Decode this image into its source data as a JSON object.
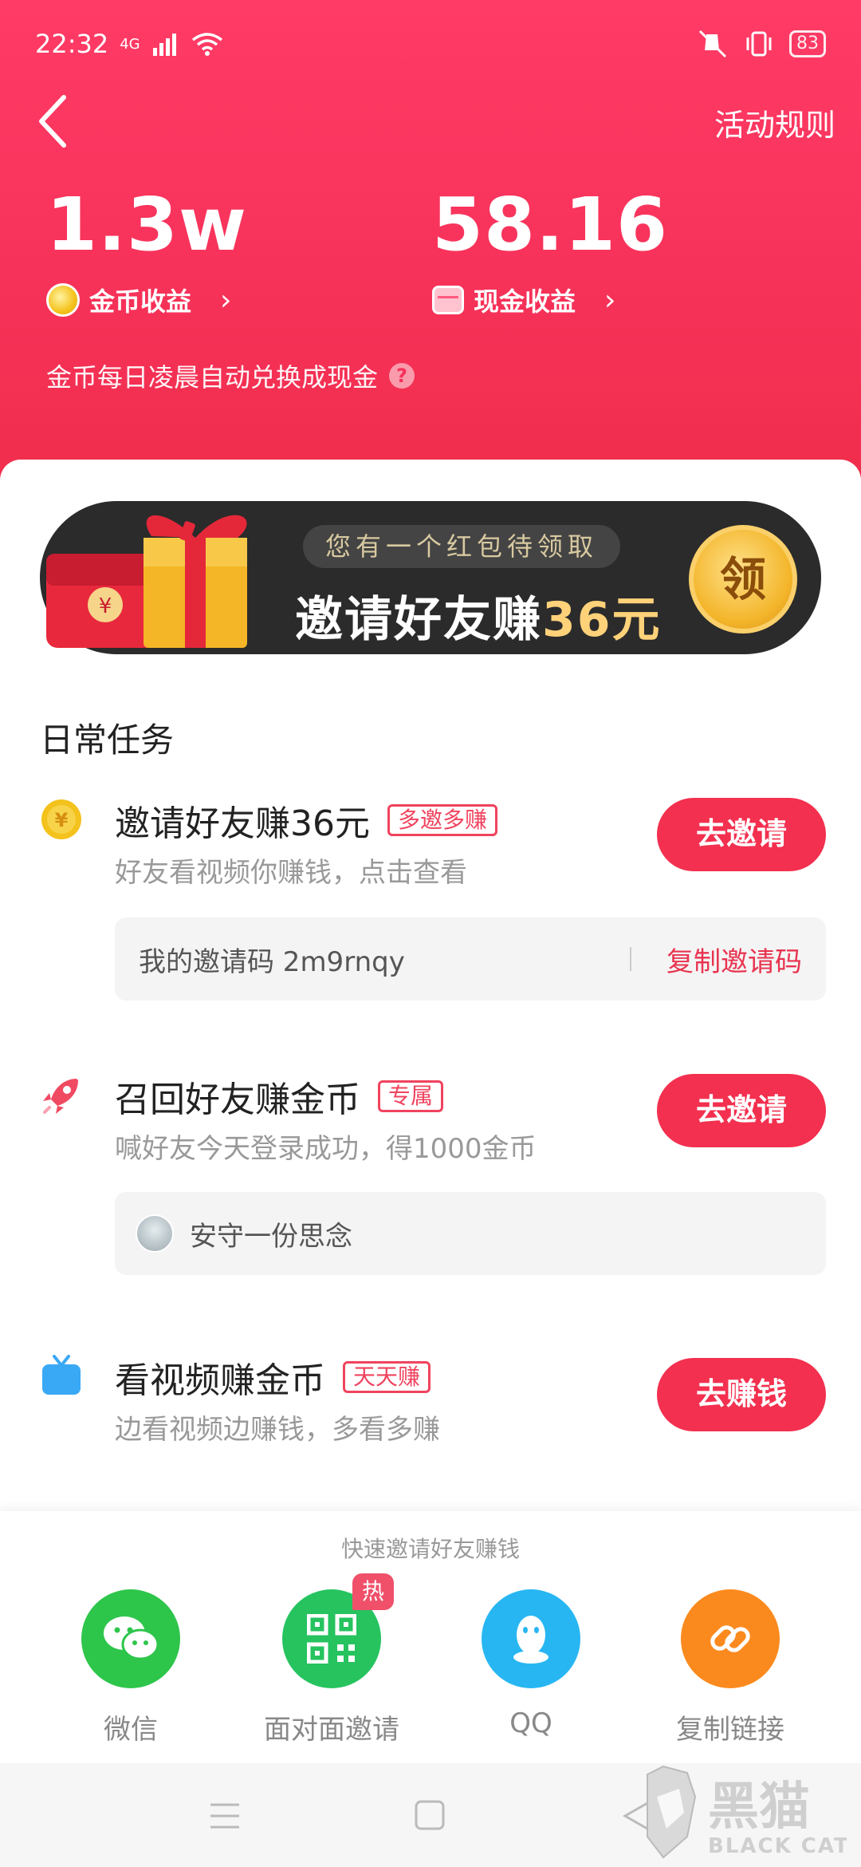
{
  "statusbar": {
    "time": "22:32",
    "network": "4G",
    "battery": "83"
  },
  "header": {
    "rules_label": "活动规则",
    "coin": {
      "value": "1.3w",
      "label": "金币收益",
      "chevron": "›"
    },
    "cash": {
      "value": "58.16",
      "label": "现金收益",
      "chevron": "›"
    },
    "note": "金币每日凌晨自动兑换成现金",
    "help": "?"
  },
  "banner": {
    "pill": "您有一个红包待领取",
    "title": "邀请好友赚",
    "amount": "36元",
    "badge": "领"
  },
  "section_title": "日常任务",
  "tasks": [
    {
      "title": "邀请好友赚36元",
      "tag": "多邀多赚",
      "sub": "好友看视频你赚钱，点击查看",
      "button": "去邀请",
      "code_label": "我的邀请码 2m9rnqy",
      "copy_label": "复制邀请码"
    },
    {
      "title": "召回好友赚金币",
      "tag": "专属",
      "sub": "喊好友今天登录成功，得1000金币",
      "button": "去邀请",
      "friend_name": "安守一份思念"
    },
    {
      "title": "看视频赚金币",
      "tag": "天天赚",
      "sub": "边看视频边赚钱，多看多赚",
      "button": "去赚钱"
    }
  ],
  "share_sheet": {
    "title": "快速邀请好友赚钱",
    "hot_label": "热",
    "items": [
      {
        "name": "微信",
        "icon": "wechat-icon",
        "color": "#2ec54b"
      },
      {
        "name": "面对面邀请",
        "icon": "qrcode-icon",
        "color": "#26c35f"
      },
      {
        "name": "QQ",
        "icon": "qq-icon",
        "color": "#27b6f2"
      },
      {
        "name": "复制链接",
        "icon": "link-icon",
        "color": "#fb8a1e"
      }
    ]
  },
  "watermark": {
    "text": "黑猫",
    "sub": "BLACK CAT"
  },
  "colors": {
    "primary": "#f3304f",
    "header": "#f7325a",
    "gold": "#f4c21c"
  }
}
